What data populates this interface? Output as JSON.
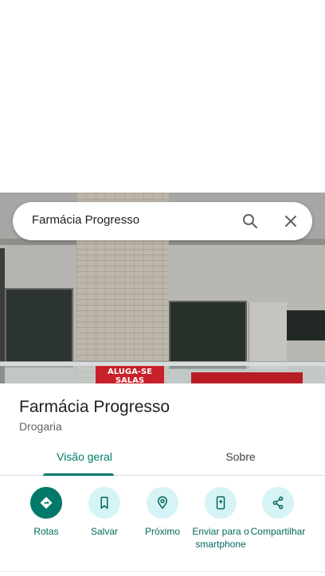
{
  "search": {
    "query": "Farmácia Progresso"
  },
  "photo": {
    "sign_text": "ALUGA-SE SALAS COMERCIAIS"
  },
  "place": {
    "name": "Farmácia Progresso",
    "category": "Drogaria"
  },
  "tabs": [
    {
      "label": "Visão geral",
      "active": true
    },
    {
      "label": "Sobre",
      "active": false
    }
  ],
  "actions": [
    {
      "label": "Rotas",
      "icon": "directions-icon"
    },
    {
      "label": "Salvar",
      "icon": "bookmark-icon"
    },
    {
      "label": "Próximo",
      "icon": "nearby-icon"
    },
    {
      "label": "Enviar para o smartphone",
      "icon": "send-to-phone-icon"
    },
    {
      "label": "Compartilhar",
      "icon": "share-icon"
    }
  ],
  "colors": {
    "accent": "#00796b",
    "action_bg": "#d6f3f5",
    "sign_red": "#c8202a"
  }
}
